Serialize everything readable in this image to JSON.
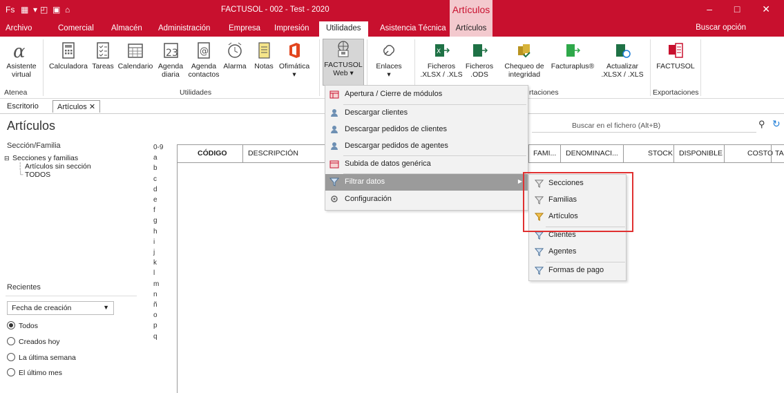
{
  "titlebar": {
    "quick_access": "Fs",
    "title": "FACTUSOL - 002 - Test - 2020",
    "context_title": "Artículos",
    "window_controls": "– □ ✕"
  },
  "menu": {
    "items": [
      "Archivo",
      "Comercial",
      "Almacén",
      "Administración",
      "Empresa",
      "Impresión",
      "Utilidades",
      "Asistencia Técnica",
      "Artículos"
    ],
    "buscar": "Buscar opción"
  },
  "ribbon": {
    "asistente": "Asistente\nvirtual",
    "calculadora": "Calculadora",
    "tareas": "Tareas",
    "calendario": "Calendario",
    "agenda_diaria": "Agenda\ndiaria",
    "agenda_contactos": "Agenda\ncontactos",
    "alarma": "Alarma",
    "notas": "Notas",
    "ofimatica": "Ofimática",
    "factusol_web": "FACTUSOL\nWeb ▾",
    "enlaces": "Enlaces",
    "ficheros_xlsx": "Ficheros\n.XLSX / .XLS",
    "ficheros_ods": "Ficheros\n.ODS",
    "chequeo": "Chequeo de\nintegridad",
    "facturaplus": "Facturaplus®",
    "actualizar": "Actualizar\n.XLSX / .XLS",
    "factusol": "FACTUSOL",
    "groups": {
      "atenea": "Atenea",
      "utilidades": "Utilidades",
      "importaciones": "rtaciones",
      "exportaciones": "Exportaciones"
    }
  },
  "tabs": {
    "escritorio": "Escritorio",
    "articulos": "Artículos ✕"
  },
  "page": {
    "title": "Artículos",
    "search_placeholder": "Buscar en el fichero (Alt+B)"
  },
  "left": {
    "header": "Sección/Familia",
    "tree_root": "Secciones y familias",
    "tree_children": [
      "Artículos sin sección",
      "TODOS"
    ],
    "recientes": "Recientes",
    "fecha": "Fecha de creación",
    "radios": [
      "Todos",
      "Creados hoy",
      "La última semana",
      "El último mes"
    ]
  },
  "alphabet": [
    "0-9",
    "a",
    "b",
    "c",
    "d",
    "e",
    "f",
    "g",
    "h",
    "i",
    "j",
    "k",
    "l",
    "m",
    "n",
    "ñ",
    "o",
    "p",
    "q"
  ],
  "table": {
    "columns": [
      "CÓDIGO",
      "DESCRIPCIÓN",
      "FAMI...",
      "DENOMINACI...",
      "STOCK",
      "DISPONIBLE",
      "COSTO",
      "TA"
    ]
  },
  "dropdown": {
    "items": [
      "Apertura / Cierre de módulos",
      "Descargar clientes",
      "Descargar pedidos de clientes",
      "Descargar pedidos de agentes",
      "Subida de datos genérica",
      "Filtrar datos",
      "Configuración"
    ]
  },
  "submenu": {
    "items": [
      "Secciones",
      "Familias",
      "Artículos",
      "Clientes",
      "Agentes",
      "Formas de pago"
    ]
  },
  "colors": {
    "brand": "#c8102e",
    "highlight": "#e03030"
  }
}
